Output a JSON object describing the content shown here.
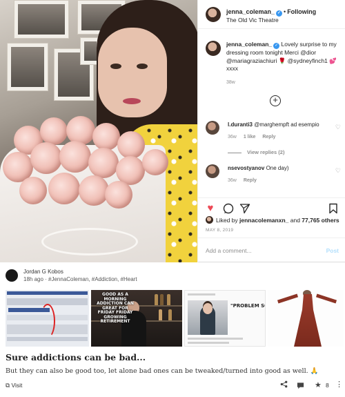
{
  "instagram": {
    "header": {
      "username": "jenna_coleman_",
      "follow_label": "Following",
      "location": "The Old Vic Theatre"
    },
    "caption": {
      "username": "jenna_coleman_",
      "text": " Lovely surprise to my dressing room tonight Merci @dior @mariagraziachiuri 🌹 @sydneyfinch1 💕 xxxx",
      "time": "38w"
    },
    "comments": [
      {
        "username": "l.duranti3",
        "text": " @marghempft ad esempio",
        "time": "36w",
        "likes": "1 like",
        "reply_label": "Reply"
      },
      {
        "username": "nsevostyanov",
        "text": " One day)",
        "time": "36w",
        "reply_label": "Reply"
      }
    ],
    "view_replies": "View replies (2)",
    "liked_by_prefix": "Liked by ",
    "liked_by_user": "jennacolemanxn_",
    "liked_by_and": " and ",
    "liked_by_count": "77,765 others",
    "date": "MAY 8, 2019",
    "add_comment_placeholder": "Add a comment...",
    "post_label": "Post"
  },
  "feed_post": {
    "author": "Jordan G Kobos",
    "time": "18h ago",
    "tags": "#JennaColeman, #Addiction, #Heart",
    "meme_text": "GOOD AS A MORNING ADDICTION CAN GREAT FOR FRIDAY FRIDAY GROWING RETIREMENT",
    "quote_text": "\"PROBLEM SOLVE\"",
    "title": "Sure addictions can be bad...",
    "body": "But they can also be good too, let alone bad ones can be tweaked/turned into good as well. 🙏",
    "visit_label": "Visit",
    "star_count": "8"
  },
  "colors": {
    "verified": "#3897f0",
    "like_heart": "#ed4956",
    "post_disabled": "#b2dffc"
  },
  "icons": [
    "verified-badge-icon",
    "plus-circle-icon",
    "heart-icon",
    "comment-icon",
    "share-icon",
    "bookmark-icon",
    "external-link-icon",
    "share-post-icon",
    "chat-icon",
    "star-icon",
    "more-icon"
  ]
}
